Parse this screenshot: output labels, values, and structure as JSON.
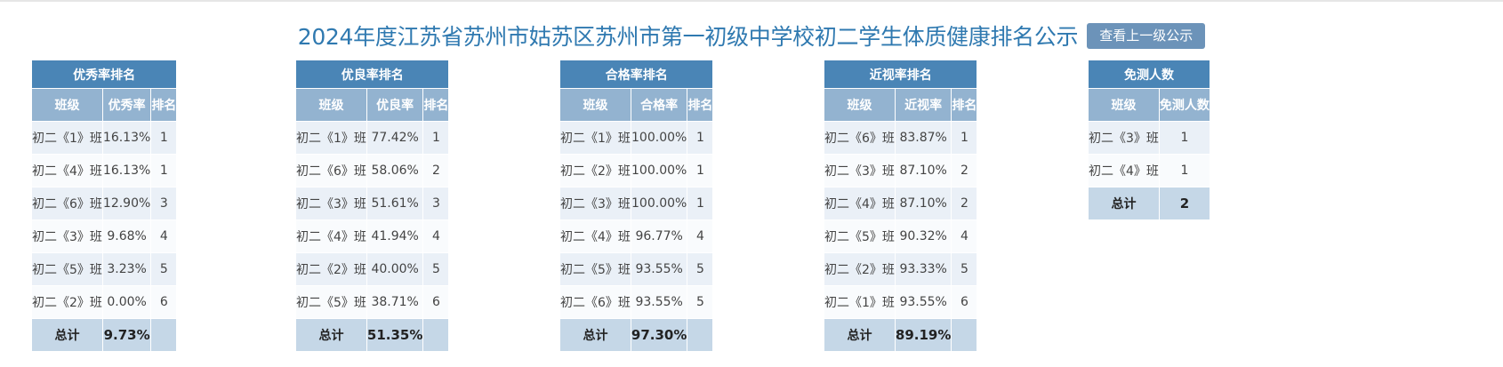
{
  "header": {
    "title": "2024年度江苏省苏州市姑苏区苏州市第一初级中学校初二学生体质健康排名公示",
    "button_label": "查看上一级公示"
  },
  "tables": [
    {
      "title": "优秀率排名",
      "columns": [
        "班级",
        "优秀率",
        "排名"
      ],
      "rows": [
        [
          "初二《1》班",
          "16.13%",
          "1"
        ],
        [
          "初二《4》班",
          "16.13%",
          "1"
        ],
        [
          "初二《6》班",
          "12.90%",
          "3"
        ],
        [
          "初二《3》班",
          "9.68%",
          "4"
        ],
        [
          "初二《5》班",
          "3.23%",
          "5"
        ],
        [
          "初二《2》班",
          "0.00%",
          "6"
        ]
      ],
      "total": [
        "总计",
        "9.73%",
        ""
      ]
    },
    {
      "title": "优良率排名",
      "columns": [
        "班级",
        "优良率",
        "排名"
      ],
      "rows": [
        [
          "初二《1》班",
          "77.42%",
          "1"
        ],
        [
          "初二《6》班",
          "58.06%",
          "2"
        ],
        [
          "初二《3》班",
          "51.61%",
          "3"
        ],
        [
          "初二《4》班",
          "41.94%",
          "4"
        ],
        [
          "初二《2》班",
          "40.00%",
          "5"
        ],
        [
          "初二《5》班",
          "38.71%",
          "6"
        ]
      ],
      "total": [
        "总计",
        "51.35%",
        ""
      ]
    },
    {
      "title": "合格率排名",
      "columns": [
        "班级",
        "合格率",
        "排名"
      ],
      "rows": [
        [
          "初二《1》班",
          "100.00%",
          "1"
        ],
        [
          "初二《2》班",
          "100.00%",
          "1"
        ],
        [
          "初二《3》班",
          "100.00%",
          "1"
        ],
        [
          "初二《4》班",
          "96.77%",
          "4"
        ],
        [
          "初二《5》班",
          "93.55%",
          "5"
        ],
        [
          "初二《6》班",
          "93.55%",
          "5"
        ]
      ],
      "total": [
        "总计",
        "97.30%",
        ""
      ]
    },
    {
      "title": "近视率排名",
      "columns": [
        "班级",
        "近视率",
        "排名"
      ],
      "rows": [
        [
          "初二《6》班",
          "83.87%",
          "1"
        ],
        [
          "初二《3》班",
          "87.10%",
          "2"
        ],
        [
          "初二《4》班",
          "87.10%",
          "2"
        ],
        [
          "初二《5》班",
          "90.32%",
          "4"
        ],
        [
          "初二《2》班",
          "93.33%",
          "5"
        ],
        [
          "初二《1》班",
          "93.55%",
          "6"
        ]
      ],
      "total": [
        "总计",
        "89.19%",
        ""
      ]
    },
    {
      "title": "免测人数",
      "columns": [
        "班级",
        "免测人数"
      ],
      "rows": [
        [
          "初二《3》班",
          "1"
        ],
        [
          "初二《4》班",
          "1"
        ]
      ],
      "total": [
        "总计",
        "2"
      ]
    }
  ],
  "colors": {
    "title_text": "#2f79b0",
    "button_bg": "#6c93b9",
    "group_header_bg": "#4a85b6",
    "column_header_bg": "#93b3d0",
    "row_odd_bg": "#eaf0f7",
    "row_even_bg": "#f9fbfd",
    "total_row_bg": "#c5d7e7"
  }
}
